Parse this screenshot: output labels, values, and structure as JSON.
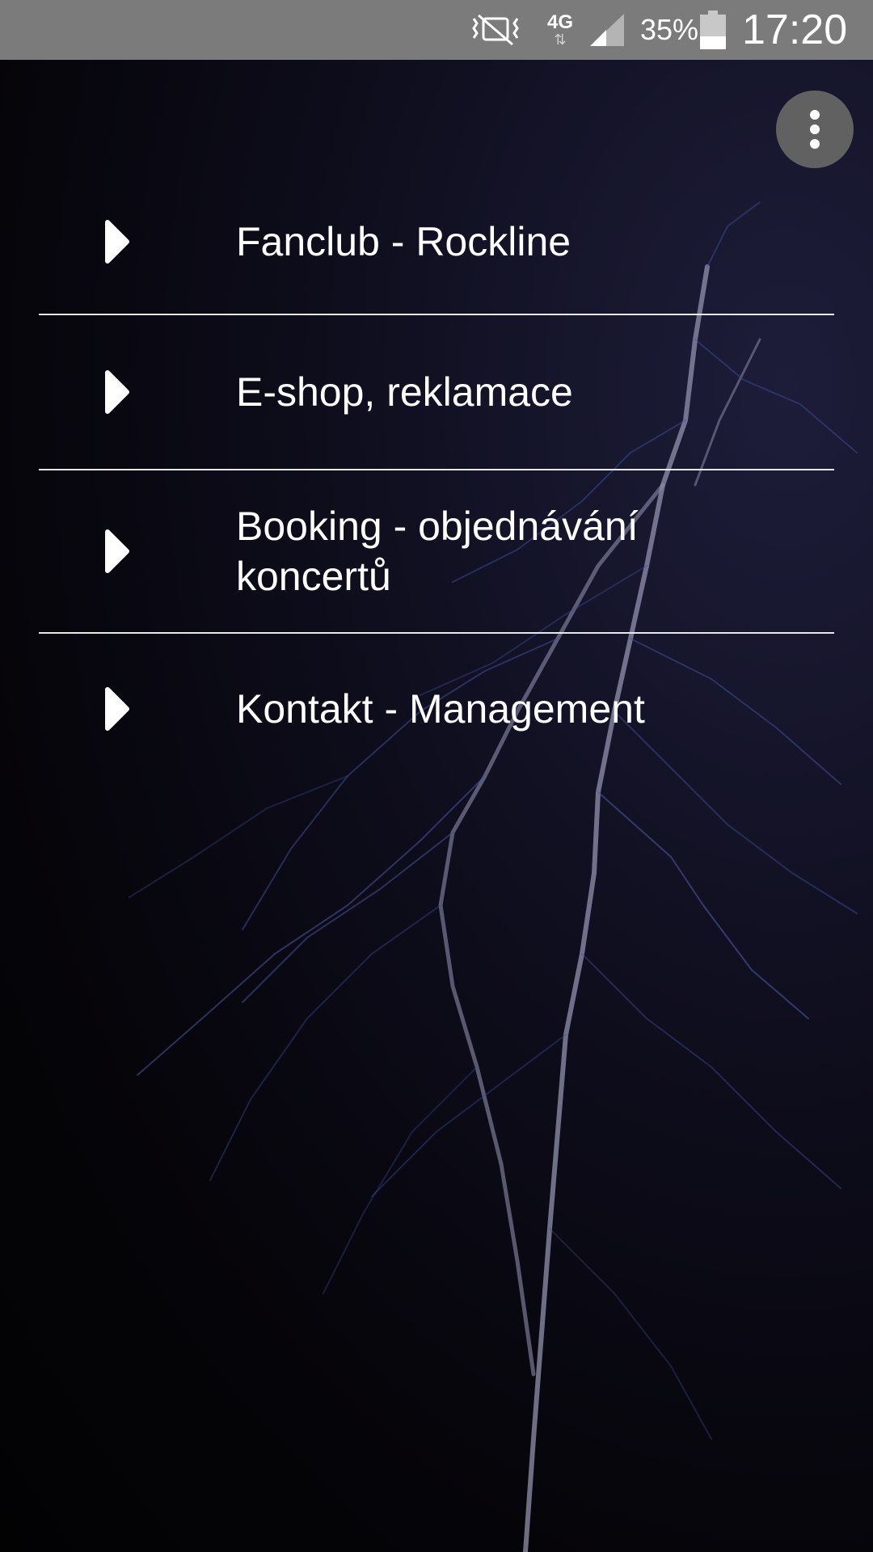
{
  "status_bar": {
    "network": "4G",
    "battery_percent": "35%",
    "time": "17:20",
    "icons": [
      "mute-vibrate-icon",
      "network-4g-icon",
      "signal-icon",
      "battery-icon"
    ]
  },
  "toolbar": {
    "overflow_icon": "more-vert-icon"
  },
  "menu": {
    "items": [
      {
        "label": "Fanclub - Rockline",
        "icon": "play-arrow-icon"
      },
      {
        "label": "E-shop, reklamace",
        "icon": "play-arrow-icon"
      },
      {
        "label": "Booking - objednávání\nkoncertů",
        "icon": "play-arrow-icon"
      },
      {
        "label": "Kontakt - Management",
        "icon": "play-arrow-icon"
      }
    ]
  },
  "colors": {
    "status_bar": "#7b7b7b",
    "text": "#ffffff",
    "divider": "#e8e8e8",
    "overflow_button": "#616161"
  }
}
